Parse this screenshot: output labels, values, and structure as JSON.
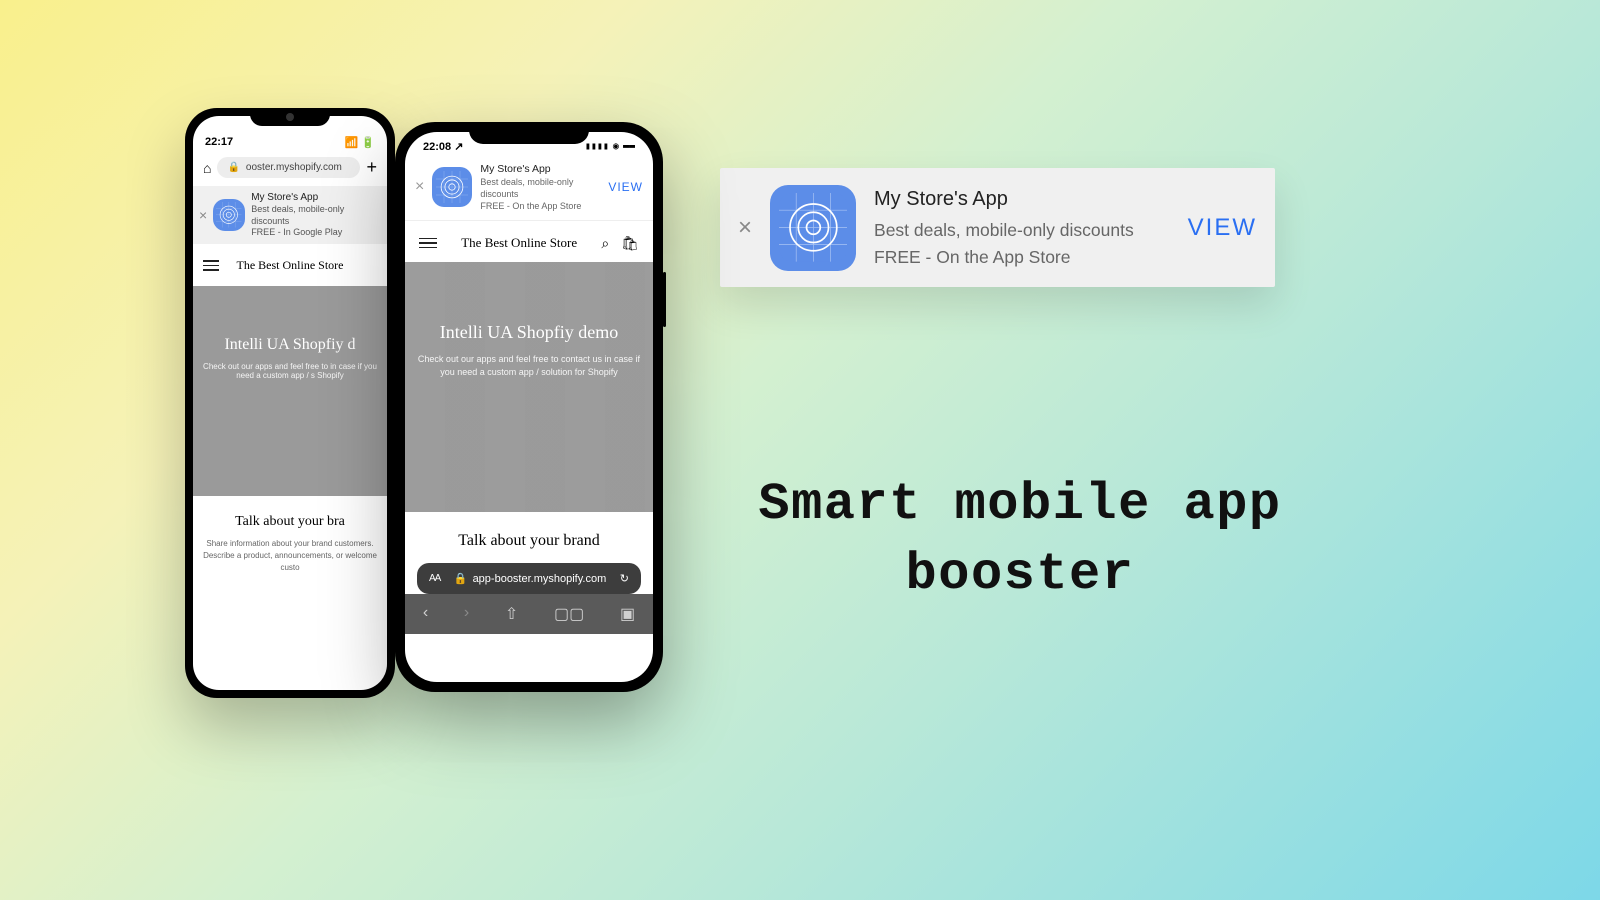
{
  "android": {
    "time": "22:17",
    "url": "ooster.myshopify.com",
    "banner": {
      "title": "My Store's App",
      "line1": "Best deals, mobile-only discounts",
      "line2": "FREE - In Google Play"
    },
    "store_title": "The Best Online Store",
    "hero": {
      "title": "Intelli UA Shopfiy d",
      "sub": "Check out our apps and feel free to\nin case if you need a custom app / s\nShopify"
    },
    "brand": {
      "title": "Talk about your bra",
      "body": "Share information about your brand\ncustomers. Describe a product,\nannouncements, or welcome custo"
    }
  },
  "iphone": {
    "time": "22:08",
    "banner": {
      "title": "My Store's App",
      "line1": "Best deals, mobile-only discounts",
      "line2": "FREE - On the App Store",
      "cta": "VIEW"
    },
    "store_title": "The Best Online Store",
    "hero": {
      "title": "Intelli UA Shopfiy demo",
      "sub": "Check out our apps and feel free to contact us in case if you need a custom app / solution for Shopify"
    },
    "brand_title": "Talk about your brand",
    "url": "app-booster.myshopify.com",
    "aa": "AA"
  },
  "big_banner": {
    "title": "My Store's App",
    "line1": "Best deals, mobile-only discounts",
    "line2": "FREE - On the App Store",
    "cta": "VIEW"
  },
  "headline": "Smart mobile app booster"
}
